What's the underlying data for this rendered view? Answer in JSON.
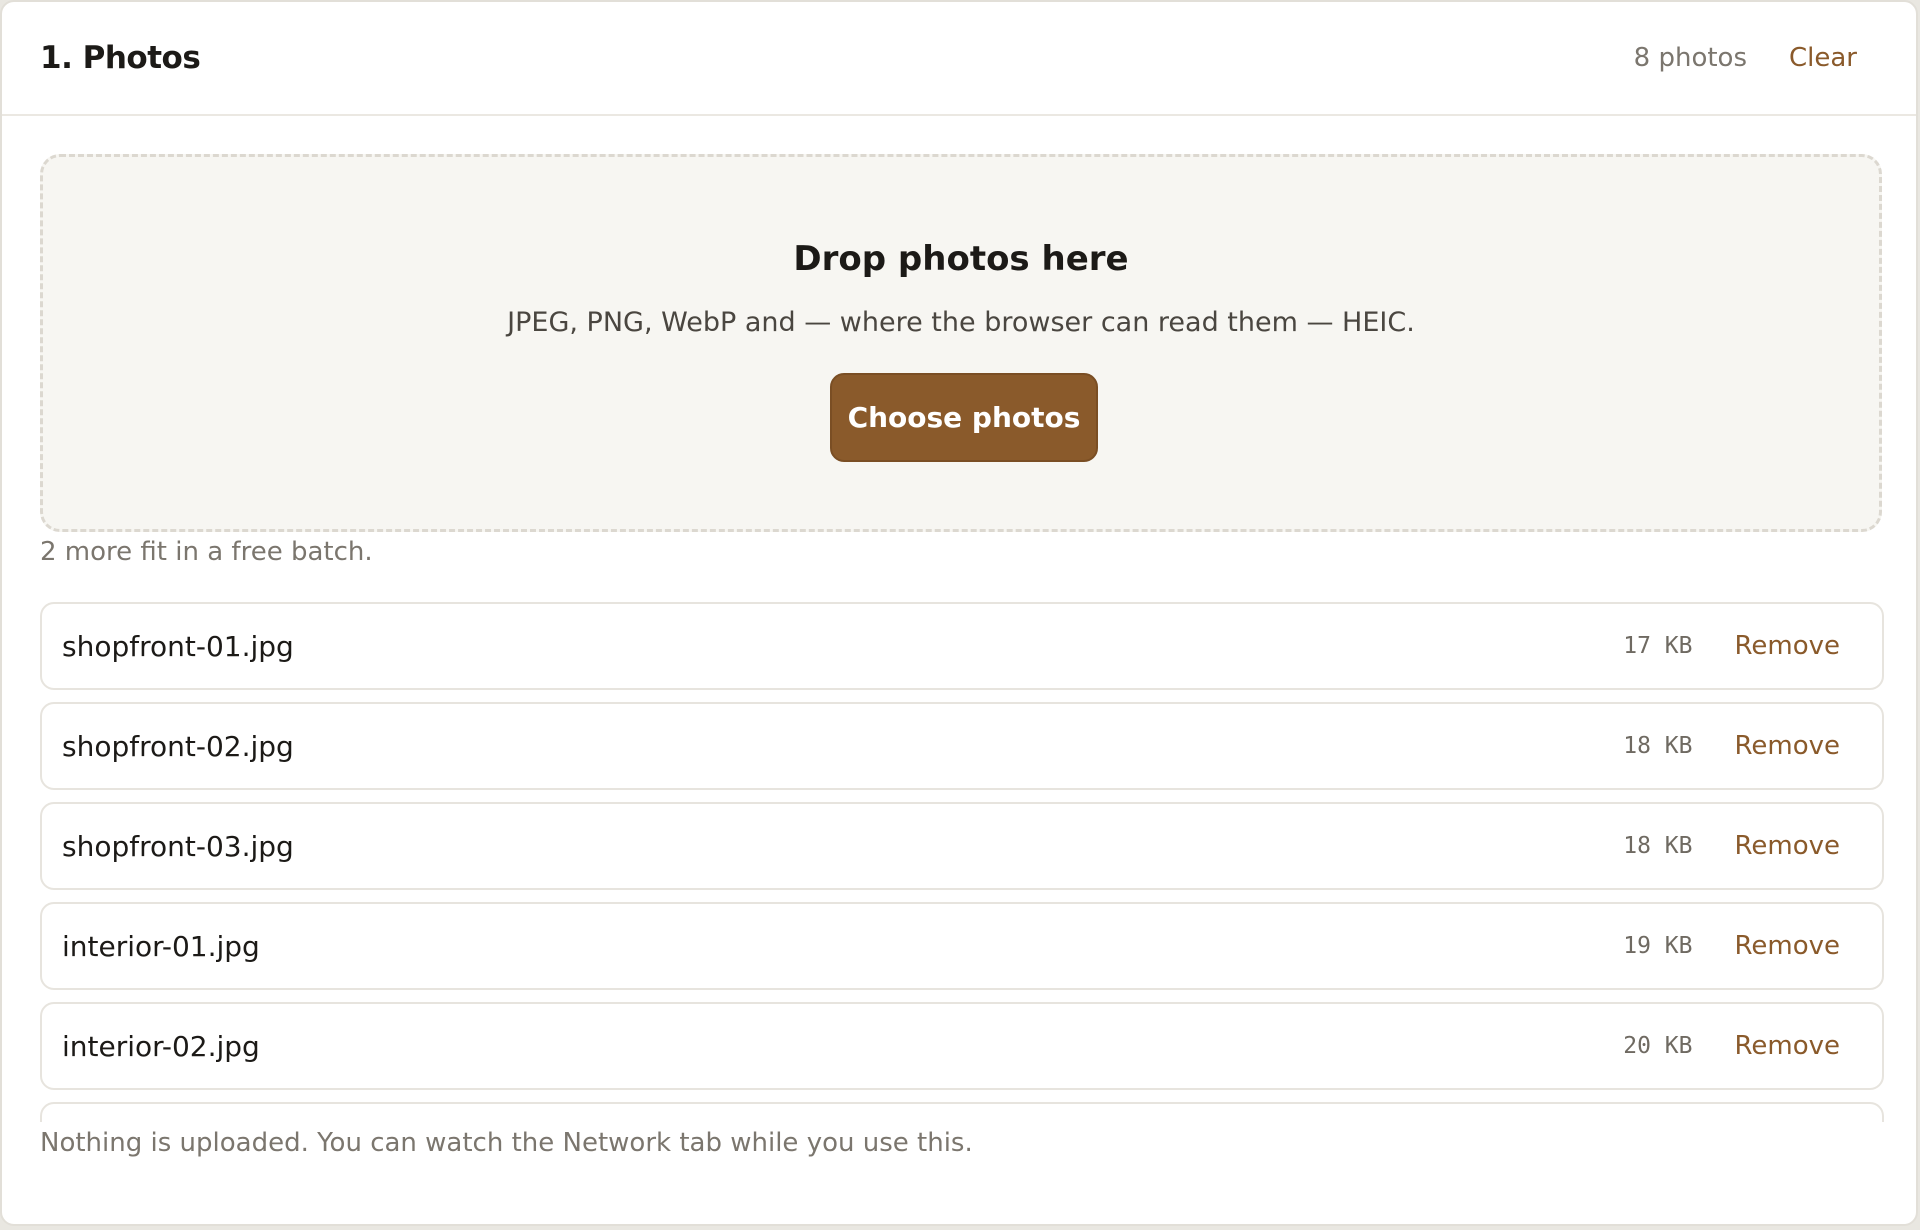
{
  "header": {
    "title": "1. Photos",
    "count": "8 photos",
    "clear_label": "Clear"
  },
  "dropzone": {
    "title": "Drop photos here",
    "hint": "JPEG, PNG, WebP and — where the browser can read them — HEIC.",
    "button_label": "Choose photos"
  },
  "batch_note": "2 more fit in a free batch.",
  "files": [
    {
      "name": "shopfront-01.jpg",
      "size": "17 KB",
      "remove_label": "Remove"
    },
    {
      "name": "shopfront-02.jpg",
      "size": "18 KB",
      "remove_label": "Remove"
    },
    {
      "name": "shopfront-03.jpg",
      "size": "18 KB",
      "remove_label": "Remove"
    },
    {
      "name": "interior-01.jpg",
      "size": "19 KB",
      "remove_label": "Remove"
    },
    {
      "name": "interior-02.jpg",
      "size": "20 KB",
      "remove_label": "Remove"
    }
  ],
  "footer_note": "Nothing is uploaded. You can watch the Network tab while you use this.",
  "colors": {
    "accent": "#8a5a2b",
    "muted_text": "#7b766e",
    "dropzone_bg": "#f7f6f2"
  }
}
